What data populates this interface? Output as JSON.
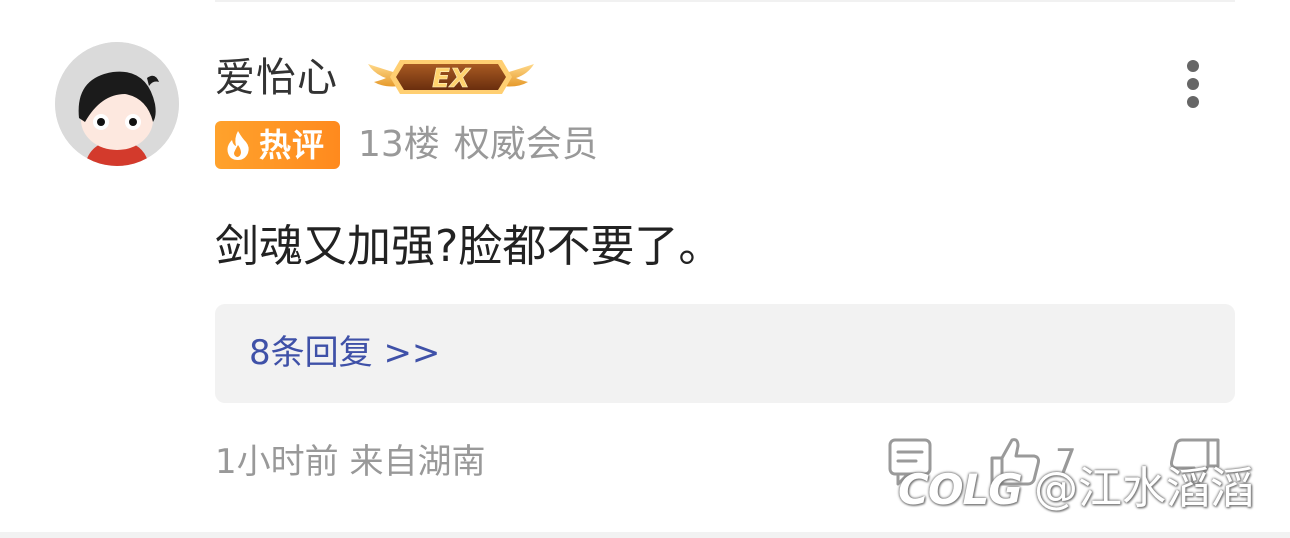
{
  "comment": {
    "username": "爱怡心",
    "level_badge_text": "EX",
    "hot_badge_label": "热评",
    "floor": "13楼",
    "role": "权威会员",
    "text": "剑魂又加强?脸都不要了。",
    "replies_label": "8条回复 >>",
    "time_location": "1小时前 来自湖南",
    "like_count": "7"
  },
  "watermark": {
    "logo": "COLG",
    "user": "@江水滔滔"
  },
  "icons": {
    "more": "more-vertical-icon",
    "comment": "comment-icon",
    "like": "thumbs-up-icon",
    "dislike": "thumbs-down-icon",
    "hot": "flame-icon"
  },
  "colors": {
    "hot_badge": "#ff9a26",
    "reply_link": "#3f51a8",
    "meta_text": "#999999"
  }
}
